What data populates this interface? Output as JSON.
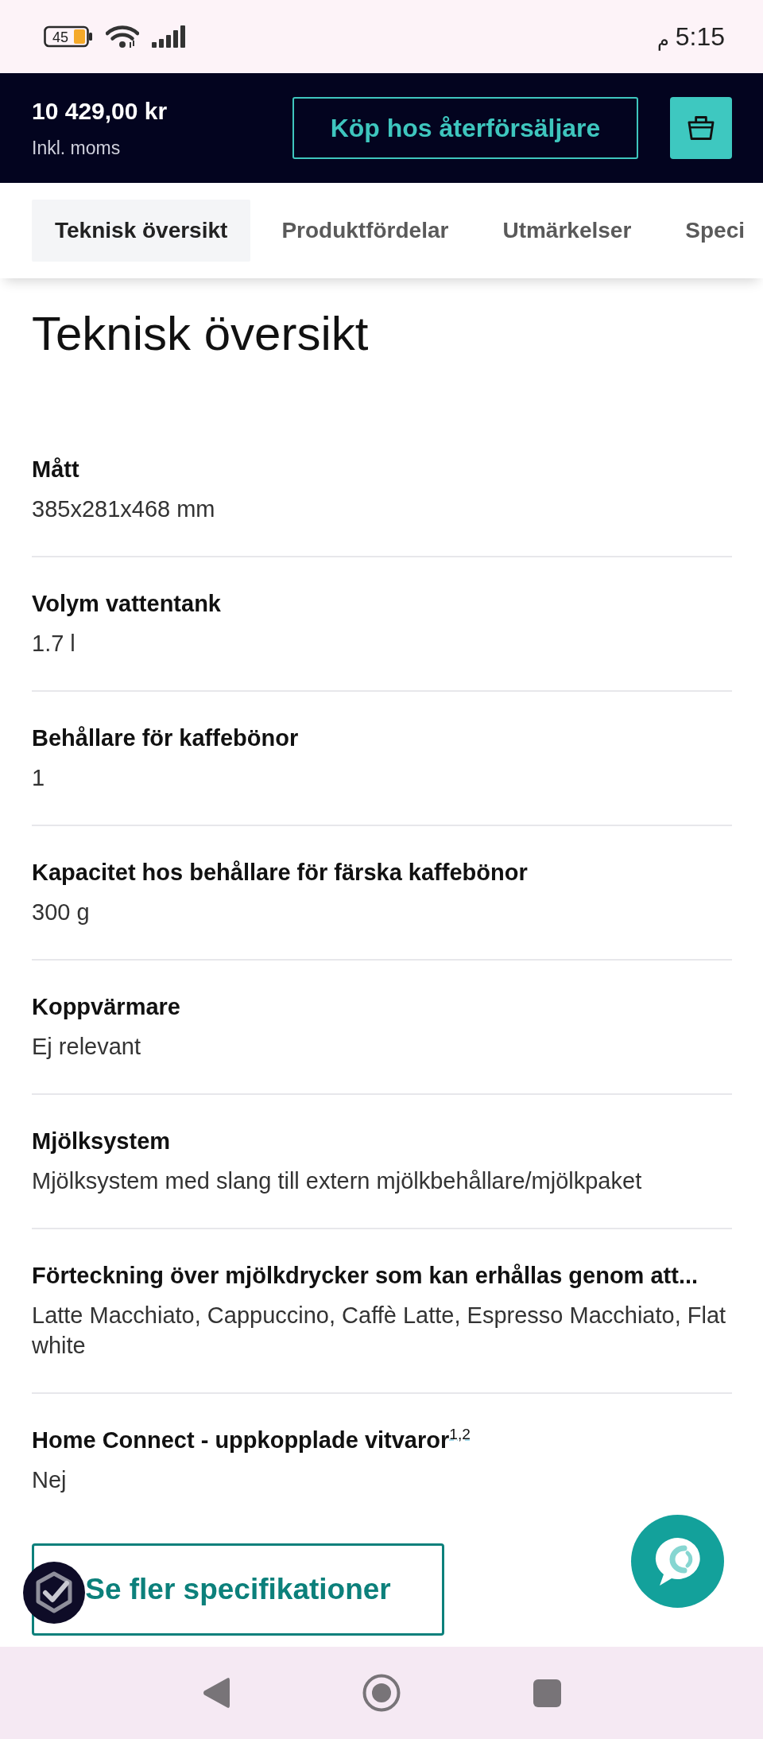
{
  "status_bar": {
    "battery": "45",
    "period": "م",
    "time": "5:15"
  },
  "header": {
    "price": "10 429,00 kr",
    "price_note": "Inkl. moms",
    "buy_button": "Köp hos återförsäljare"
  },
  "tabs": [
    {
      "label": "Teknisk översikt",
      "selected": true
    },
    {
      "label": "Produktfördelar",
      "selected": false
    },
    {
      "label": "Utmärkelser",
      "selected": false
    },
    {
      "label": "Speci",
      "selected": false
    }
  ],
  "section": {
    "title": "Teknisk översikt",
    "specs": [
      {
        "label": "Mått",
        "value": "385x281x468 mm"
      },
      {
        "label": "Volym vattentank",
        "value": "1.7 l"
      },
      {
        "label": "Behållare för kaffebönor",
        "value": "1"
      },
      {
        "label": "Kapacitet hos behållare för färska kaffebönor",
        "value": "300 g"
      },
      {
        "label": "Koppvärmare",
        "value": "Ej relevant"
      },
      {
        "label": "Mjölksystem",
        "value": "Mjölksystem med slang till extern mjölkbehållare/mjölkpaket"
      },
      {
        "label": "Förteckning över mjölkdrycker som kan erhållas genom att...",
        "value": "Latte Macchiato, Cappuccino, Caffè Latte, Espresso Macchiato, Flat white"
      },
      {
        "label": "Home Connect - uppkopplade vitvaror$^{1,2}$",
        "value": "Nej"
      }
    ]
  },
  "more_button": "Se fler specifikationer"
}
